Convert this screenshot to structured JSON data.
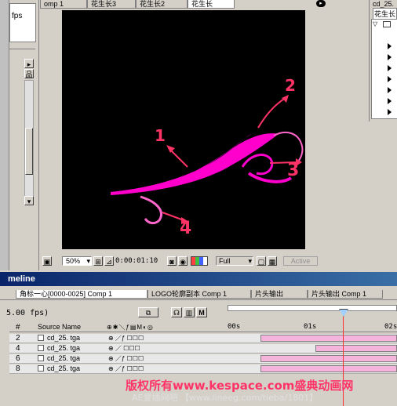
{
  "left_panel": {
    "fps_label": "fps"
  },
  "comp_tabs": [
    "omp 1",
    "花生长3",
    "花生长2",
    "花生长"
  ],
  "project": {
    "item": "cd_25.",
    "selected": "花生长"
  },
  "viewer": {
    "annotations": [
      "1",
      "2",
      "3",
      "4"
    ],
    "zoom": "50%",
    "timecode": "0:00:01:10",
    "resolution": "Full",
    "active": "Active"
  },
  "timeline": {
    "title": "meline",
    "tabs": [
      "角标一心[0000-0025] Comp 1",
      "LOGO轮廓副本 Comp 1",
      "片头输出",
      "片头输出 Comp 1"
    ],
    "fps": "5.00 fps)",
    "col_num": "#",
    "col_source": "Source Name",
    "ruler": [
      "00s",
      "01s",
      "02s"
    ],
    "layers": [
      {
        "num": "2",
        "name": "cd_25. tga"
      },
      {
        "num": "4",
        "name": "cd_25. tga"
      },
      {
        "num": "6",
        "name": "cd_25. tga"
      },
      {
        "num": "8",
        "name": "cd_25. tga"
      }
    ]
  },
  "watermark": {
    "line1": "版权所有www.kespace.com盛典动画网",
    "line2": "AE爱插网吧 【www.lineeg.com/tieba/1801】"
  },
  "colors": {
    "flower": "#ff00cc",
    "annotation": "#ff3366",
    "timeline_bar": "#f4b4dc",
    "title_bar": "#0a246a"
  }
}
